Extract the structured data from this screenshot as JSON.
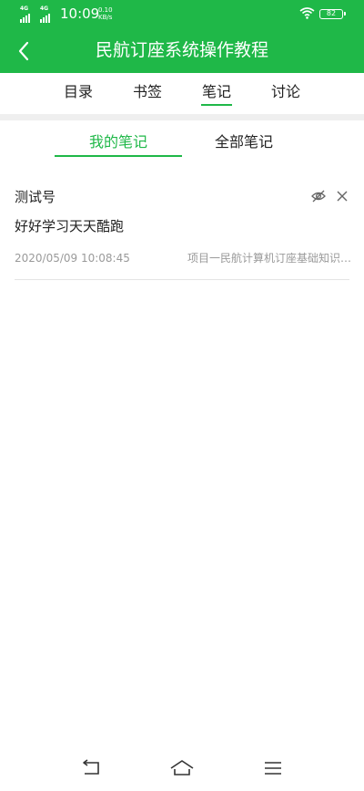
{
  "status": {
    "signal1": "4G",
    "signal2": "4G",
    "time": "10:09",
    "speed_value": "0.10",
    "speed_unit": "KB/s",
    "battery": "82"
  },
  "header": {
    "title": "民航订座系统操作教程",
    "back_icon": "chevron-left-icon"
  },
  "tabs": [
    {
      "label": "目录"
    },
    {
      "label": "书签"
    },
    {
      "label": "笔记",
      "active": true
    },
    {
      "label": "讨论"
    }
  ],
  "subtabs": [
    {
      "label": "我的笔记",
      "active": true
    },
    {
      "label": "全部笔记"
    }
  ],
  "notes": [
    {
      "user": "测试号",
      "content": "好好学习天天酷跑",
      "timestamp": "2020/05/09 10:08:45",
      "source": "项目一民航计算机订座基础知识…",
      "icons": [
        "eye-off-icon",
        "close-icon"
      ]
    }
  ],
  "navbar": {
    "icons": [
      "back-nav-icon",
      "home-nav-icon",
      "menu-nav-icon"
    ]
  },
  "colors": {
    "accent": "#1fb848",
    "text": "#222222",
    "muted": "#9a9a9a"
  }
}
